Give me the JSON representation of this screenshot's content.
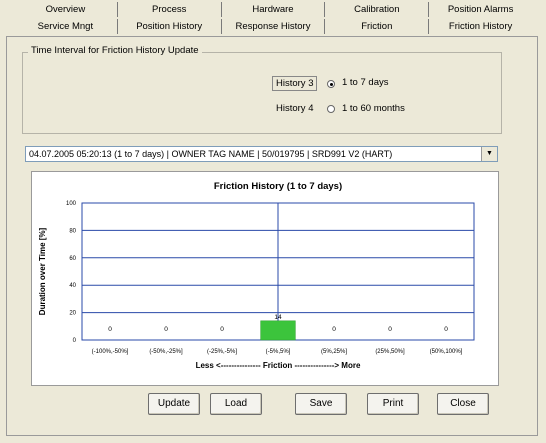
{
  "tabs_row1": [
    "Overview",
    "Process",
    "Hardware",
    "Calibration",
    "Position Alarms"
  ],
  "tabs_row2": [
    "Service Mngt",
    "Position History",
    "Response History",
    "Friction",
    "Friction History"
  ],
  "active_tab": "Friction History",
  "group_title": "Time Interval for Friction History Update",
  "history3": {
    "label": "History 3",
    "option": "1 to 7 days",
    "selected": true
  },
  "history4": {
    "label": "History 4",
    "option": "1 to 60 months",
    "selected": false
  },
  "device_select": {
    "value": "04.07.2005 05:20:13 (1 to 7 days) | OWNER TAG NAME   | 50/019795 | SRD991 V2 (HART)"
  },
  "chart_data": {
    "type": "bar",
    "title": "Friction History (1 to 7 days)",
    "ylabel": "Duration over Time [%]",
    "xlabel": "Less <--------------- Friction ---------------> More",
    "categories": [
      "(-100%,-50%]",
      "(-50%,-25%]",
      "(-25%,-5%]",
      "(-5%,5%]",
      "(5%,25%]",
      "(25%,50%]",
      "(50%,100%]"
    ],
    "values": [
      0,
      0,
      0,
      14,
      0,
      0,
      0
    ],
    "ylim": [
      0,
      100
    ],
    "yticks": [
      0,
      20,
      40,
      60,
      80,
      100
    ],
    "bar_color": "#3cc43c",
    "grid_color": "#2a4aa8",
    "grid": true
  },
  "buttons": {
    "update": "Update",
    "load": "Load",
    "save": "Save",
    "print": "Print",
    "close": "Close"
  }
}
